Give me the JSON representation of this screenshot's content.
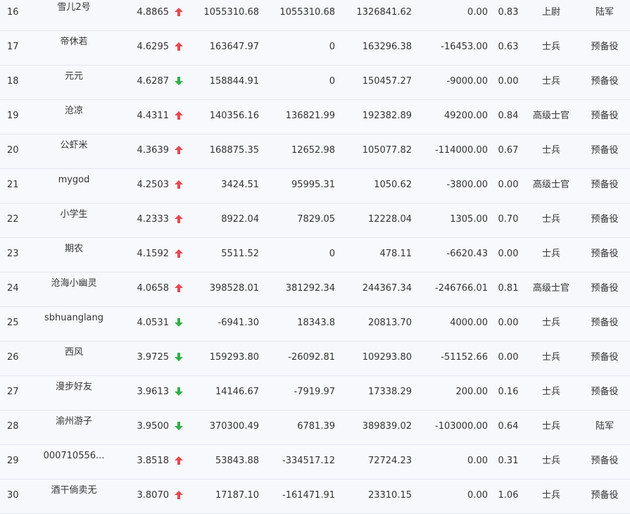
{
  "colors": {
    "up": "#e8484f",
    "down": "#33b049"
  },
  "rows": [
    {
      "rank": "16",
      "name": "雪儿2号",
      "score": "4.8865",
      "trend": "up",
      "v1": "1055310.68",
      "v2": "1055310.68",
      "v3": "1326841.62",
      "v4": "0.00",
      "ratio": "0.83",
      "title": "上尉",
      "army": "陆军"
    },
    {
      "rank": "17",
      "name": "帝休若",
      "score": "4.6295",
      "trend": "up",
      "v1": "163647.97",
      "v2": "0",
      "v3": "163296.38",
      "v4": "-16453.00",
      "ratio": "0.63",
      "title": "士兵",
      "army": "预备役"
    },
    {
      "rank": "18",
      "name": "元元",
      "score": "4.6287",
      "trend": "down",
      "v1": "158844.91",
      "v2": "0",
      "v3": "150457.27",
      "v4": "-9000.00",
      "ratio": "0.00",
      "title": "士兵",
      "army": "预备役"
    },
    {
      "rank": "19",
      "name": "沧凉",
      "score": "4.4311",
      "trend": "up",
      "v1": "140356.16",
      "v2": "136821.99",
      "v3": "192382.89",
      "v4": "49200.00",
      "ratio": "0.84",
      "title": "高级士官",
      "army": "预备役"
    },
    {
      "rank": "20",
      "name": "公虾米",
      "score": "4.3639",
      "trend": "up",
      "v1": "168875.35",
      "v2": "12652.98",
      "v3": "105077.82",
      "v4": "-114000.00",
      "ratio": "0.67",
      "title": "士兵",
      "army": "预备役"
    },
    {
      "rank": "21",
      "name": "mygod",
      "score": "4.2503",
      "trend": "up",
      "v1": "3424.51",
      "v2": "95995.31",
      "v3": "1050.62",
      "v4": "-3800.00",
      "ratio": "0.00",
      "title": "高级士官",
      "army": "预备役"
    },
    {
      "rank": "22",
      "name": "小学生",
      "score": "4.2333",
      "trend": "up",
      "v1": "8922.04",
      "v2": "7829.05",
      "v3": "12228.04",
      "v4": "1305.00",
      "ratio": "0.70",
      "title": "士兵",
      "army": "预备役"
    },
    {
      "rank": "23",
      "name": "期农",
      "score": "4.1592",
      "trend": "up",
      "v1": "5511.52",
      "v2": "0",
      "v3": "478.11",
      "v4": "-6620.43",
      "ratio": "0.00",
      "title": "士兵",
      "army": "预备役"
    },
    {
      "rank": "24",
      "name": "沧海小幽灵",
      "score": "4.0658",
      "trend": "up",
      "v1": "398528.01",
      "v2": "381292.34",
      "v3": "244367.34",
      "v4": "-246766.01",
      "ratio": "0.81",
      "title": "高级士官",
      "army": "预备役"
    },
    {
      "rank": "25",
      "name": "sbhuanglang",
      "score": "4.0531",
      "trend": "down",
      "v1": "-6941.30",
      "v2": "18343.8",
      "v3": "20813.70",
      "v4": "4000.00",
      "ratio": "0.00",
      "title": "士兵",
      "army": "预备役"
    },
    {
      "rank": "26",
      "name": "西风",
      "score": "3.9725",
      "trend": "down",
      "v1": "159293.80",
      "v2": "-26092.81",
      "v3": "109293.80",
      "v4": "-51152.66",
      "ratio": "0.00",
      "title": "士兵",
      "army": "预备役"
    },
    {
      "rank": "27",
      "name": "漫步好友",
      "score": "3.9613",
      "trend": "down",
      "v1": "14146.67",
      "v2": "-7919.97",
      "v3": "17338.29",
      "v4": "200.00",
      "ratio": "0.16",
      "title": "士兵",
      "army": "预备役"
    },
    {
      "rank": "28",
      "name": "渝州游子",
      "score": "3.9500",
      "trend": "down",
      "v1": "370300.49",
      "v2": "6781.39",
      "v3": "389839.02",
      "v4": "-103000.00",
      "ratio": "0.64",
      "title": "士兵",
      "army": "陆军"
    },
    {
      "rank": "29",
      "name": "000710556...",
      "score": "3.8518",
      "trend": "up",
      "v1": "53843.88",
      "v2": "-334517.12",
      "v3": "72724.23",
      "v4": "0.00",
      "ratio": "0.31",
      "title": "士兵",
      "army": "预备役"
    },
    {
      "rank": "30",
      "name": "酒干倘卖无",
      "score": "3.8070",
      "trend": "up",
      "v1": "17187.10",
      "v2": "-161471.91",
      "v3": "23310.15",
      "v4": "0.00",
      "ratio": "1.06",
      "title": "士兵",
      "army": "预备役"
    }
  ]
}
